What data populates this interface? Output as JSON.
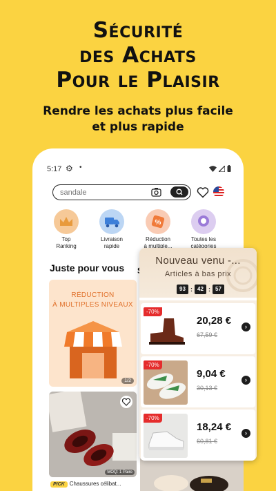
{
  "promo": {
    "headline_line1": "Sécurité",
    "headline_line2": "des Achats",
    "headline_line3": "Pour le Plaisir",
    "sub_line1": "Rendre les achats plus facile",
    "sub_line2": "et plus rapide"
  },
  "status_bar": {
    "time": "5:17"
  },
  "search": {
    "placeholder": "sandale"
  },
  "categories": [
    {
      "line1": "Top",
      "line2": "Ranking",
      "icon": "crown-icon",
      "color": "#f6c998"
    },
    {
      "line1": "Livraison",
      "line2": "rapide",
      "icon": "truck-icon",
      "color": "#bcd6f4"
    },
    {
      "line1": "Réduction",
      "line2": "à multiple...",
      "icon": "discount-tag-icon",
      "color": "#f9cbb4"
    },
    {
      "line1": "Toutes les",
      "line2": "catégories",
      "icon": "grid-icon",
      "color": "#dccdf0"
    }
  ],
  "feed": {
    "section_title": "Juste pour vous",
    "side_letter": "S",
    "promo_card": {
      "line1": "RÉDUCTION",
      "line2": "À MULTIPLES NIVEAUX",
      "pager": "1/2"
    },
    "product_card": {
      "moq": "MOQ: 1 Paire",
      "pick_label": "PICK",
      "title": "Chaussures célibat..."
    }
  },
  "new_arrivals": {
    "title": "Nouveau venu -...",
    "subtitle": "Articles à bas prix",
    "timer": {
      "hours": "93",
      "minutes": "42",
      "seconds": "57"
    },
    "items": [
      {
        "badge": "-70%",
        "price": "20,28 €",
        "old_price": "67,59 €",
        "thumb": "brown-boot"
      },
      {
        "badge": "-70%",
        "price": "9,04 €",
        "old_price": "30,13 €",
        "thumb": "green-sneaker"
      },
      {
        "badge": "-70%",
        "price": "18,24 €",
        "old_price": "60,81 €",
        "thumb": "white-sneaker"
      }
    ]
  },
  "colors": {
    "background": "#fbd341",
    "badge": "#e52c2c",
    "accent_orange": "#e0702a"
  }
}
